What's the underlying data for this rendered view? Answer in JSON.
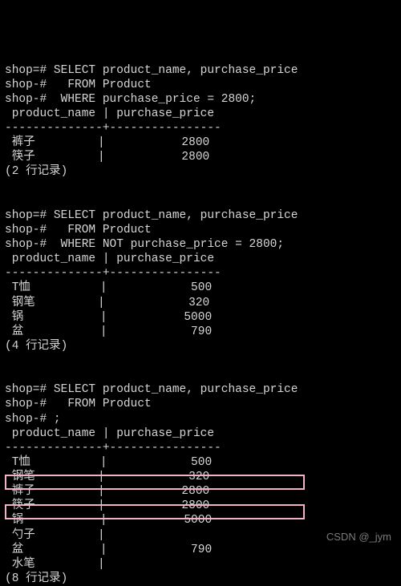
{
  "q1": {
    "l1": "shop=# SELECT product_name, purchase_price",
    "l2": "shop-#   FROM Product",
    "l3": "shop-#  WHERE purchase_price = 2800;",
    "hdr": " product_name | purchase_price",
    "sep": "--------------+----------------",
    "r1": " 裤子         |           2800",
    "r2": " 筷子         |           2800",
    "cnt": "(2 行记录)"
  },
  "q2": {
    "l1": "shop=# SELECT product_name, purchase_price",
    "l2": "shop-#   FROM Product",
    "l3": "shop-#  WHERE NOT purchase_price = 2800;",
    "hdr": " product_name | purchase_price",
    "sep": "--------------+----------------",
    "r1": " T恤          |            500",
    "r2": " 钢笔         |            320",
    "r3": " 锅           |           5000",
    "r4": " 盆           |            790",
    "cnt": "(4 行记录)"
  },
  "q3": {
    "l1": "shop=# SELECT product_name, purchase_price",
    "l2": "shop-#   FROM Product",
    "l3": "shop-# ;",
    "hdr": " product_name | purchase_price",
    "sep": "--------------+----------------",
    "r1": " T恤          |            500",
    "r2": " 钢笔         |            320",
    "r3": " 裤子         |           2800",
    "r4": " 筷子         |           2800",
    "r5": " 锅           |           5000",
    "r6": " 勺子         |",
    "r7": " 盆           |            790",
    "r8": " 水笔         |",
    "cnt": "(8 行记录)"
  },
  "watermark": "CSDN @_jym",
  "chart_data": [
    {
      "type": "table",
      "title": "WHERE purchase_price = 2800",
      "columns": [
        "product_name",
        "purchase_price"
      ],
      "rows": [
        [
          "裤子",
          2800
        ],
        [
          "筷子",
          2800
        ]
      ],
      "row_count": 2
    },
    {
      "type": "table",
      "title": "WHERE NOT purchase_price = 2800",
      "columns": [
        "product_name",
        "purchase_price"
      ],
      "rows": [
        [
          "T恤",
          500
        ],
        [
          "钢笔",
          320
        ],
        [
          "锅",
          5000
        ],
        [
          "盆",
          790
        ]
      ],
      "row_count": 4
    },
    {
      "type": "table",
      "title": "All products",
      "columns": [
        "product_name",
        "purchase_price"
      ],
      "rows": [
        [
          "T恤",
          500
        ],
        [
          "钢笔",
          320
        ],
        [
          "裤子",
          2800
        ],
        [
          "筷子",
          2800
        ],
        [
          "锅",
          5000
        ],
        [
          "勺子",
          null
        ],
        [
          "盆",
          790
        ],
        [
          "水笔",
          null
        ]
      ],
      "row_count": 8,
      "highlighted_rows": [
        "勺子",
        "水笔"
      ]
    }
  ]
}
